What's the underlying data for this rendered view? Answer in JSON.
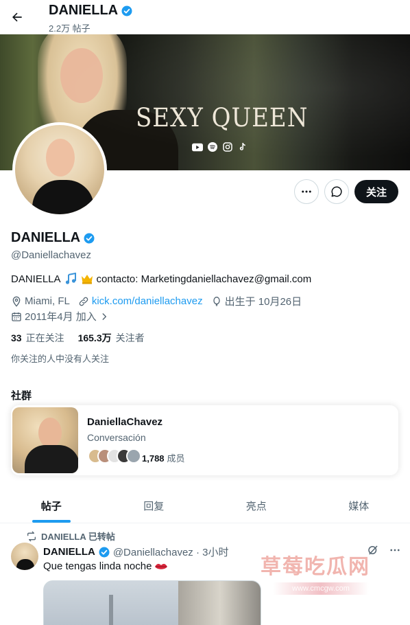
{
  "header": {
    "title": "DANIELLA",
    "post_count": "2.2万 帖子"
  },
  "banner": {
    "text": "SEXY QUEEN",
    "social_icons": [
      "youtube-icon",
      "spotify-icon",
      "instagram-icon",
      "tiktok-icon"
    ]
  },
  "actions": {
    "follow_label": "关注"
  },
  "profile": {
    "name": "DANIELLA",
    "handle": "@Daniellachavez",
    "bio_prefix": "DANIELLA",
    "bio_suffix": "contacto: Marketingdaniellachavez@gmail.com",
    "location": "Miami, FL",
    "link": "kick.com/daniellachavez",
    "birthday": "出生于 10月26日",
    "joined": "2011年4月 加入",
    "following_count": "33",
    "following_label": "正在关注",
    "followers_count": "165.3万",
    "followers_label": "关注者",
    "followed_by": "你关注的人中没有人关注"
  },
  "community": {
    "section_title": "社群",
    "name": "DaniellaChavez",
    "subtitle": "Conversación",
    "member_count": "1,788",
    "member_label": "成员"
  },
  "tabs": [
    {
      "label": "帖子",
      "active": true
    },
    {
      "label": "回复",
      "active": false
    },
    {
      "label": "亮点",
      "active": false
    },
    {
      "label": "媒体",
      "active": false
    }
  ],
  "post": {
    "retweet_label": "DANIELLA 已转帖",
    "name": "DANIELLA",
    "handle_time": "@Daniellachavez · 3小时",
    "text": "Que tengas linda noche"
  },
  "watermark": {
    "text": "草莓吃瓜网",
    "url": "www.cmcgw.com"
  },
  "colors": {
    "accent": "#1d9bf0",
    "text": "#0f1419",
    "muted": "#536471",
    "button_dark": "#0f1419"
  }
}
